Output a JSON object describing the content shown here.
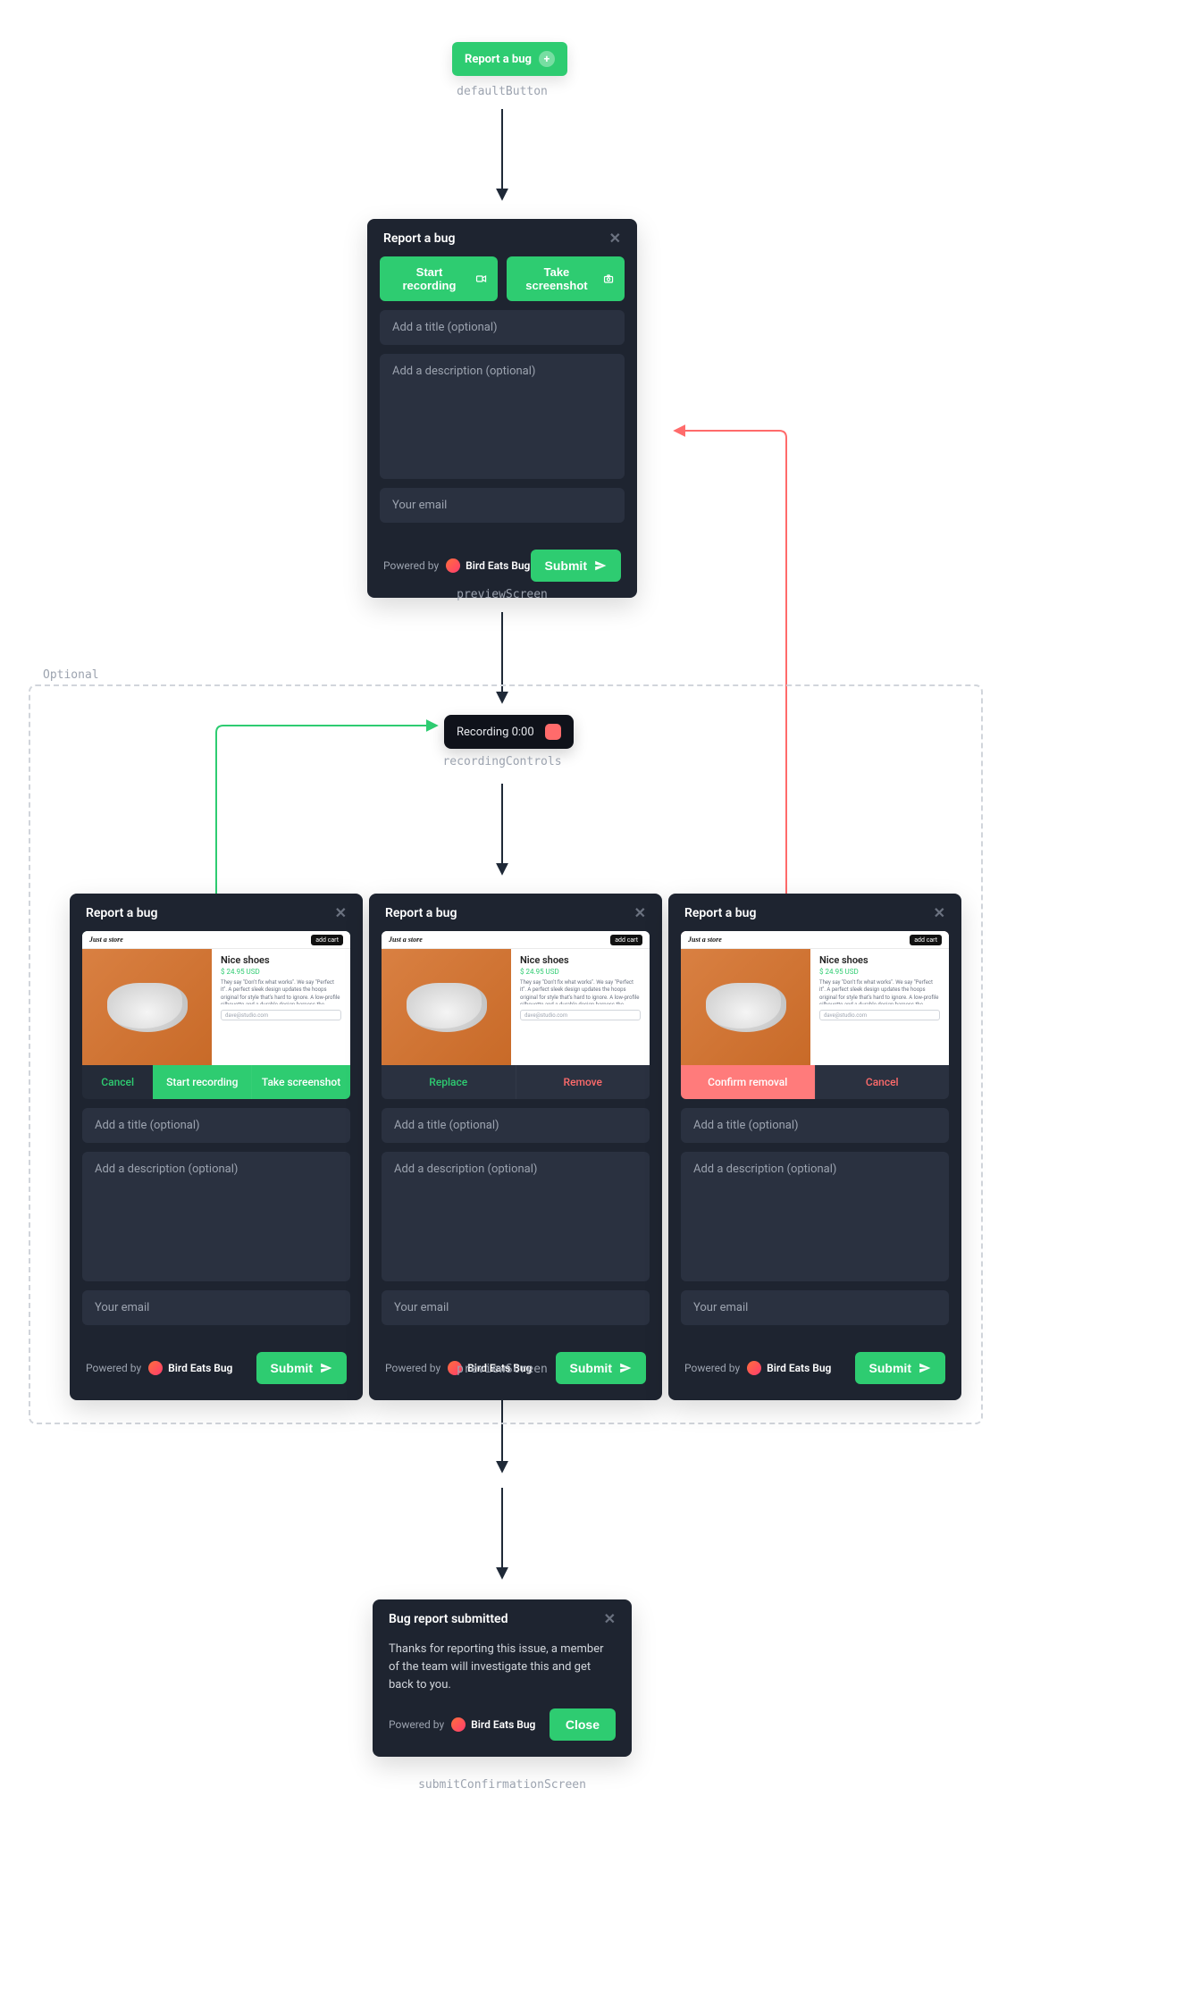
{
  "flow": {
    "optional_label": "Optional"
  },
  "labels": {
    "defaultButton": "defaultButton",
    "previewScreen1": "previewScreen",
    "recordingControls": "recordingControls",
    "previewScreen2": "previewScreen",
    "submitConfirmationScreen": "submitConfirmationScreen"
  },
  "defaultButton": {
    "label": "Report a bug"
  },
  "preview": {
    "title": "Report a bug",
    "start_recording": "Start recording",
    "take_screenshot": "Take screenshot",
    "title_placeholder": "Add a title (optional)",
    "description_placeholder": "Add a description (optional)",
    "email_placeholder": "Your email",
    "submit": "Submit",
    "powered_by": "Powered by",
    "brand": "Bird Eats Bug"
  },
  "recording": {
    "text": "Recording 0:00"
  },
  "states": {
    "left": {
      "title": "Report a bug",
      "actions": {
        "a": "Cancel",
        "b": "Start recording",
        "c": "Take screenshot"
      }
    },
    "middle": {
      "title": "Report a bug",
      "actions": {
        "a": "Replace",
        "b": "Remove"
      }
    },
    "right": {
      "title": "Report a bug",
      "actions": {
        "a": "Confirm removal",
        "b": "Cancel"
      }
    },
    "mock": {
      "brand": "Just a store",
      "cart": "add cart",
      "title": "Nice shoes",
      "price": "$ 24.95 USD",
      "blurb": "They say \"Don't fix what works\". We say \"Perfect it\". A perfect sleek design updates the hoops original for style that's hard to ignore. A low-profile silhouette and a durable design harness the simplified look you love while adobe foam on the tongue and plush collar details add tried-and-tested comfort — it's a no-brainer.",
      "email_hint": "dave@studio.com"
    },
    "form": {
      "title_placeholder": "Add a title (optional)",
      "description_placeholder": "Add a description (optional)",
      "email_placeholder": "Your email",
      "submit": "Submit",
      "powered_by": "Powered by",
      "brand": "Bird Eats Bug"
    }
  },
  "confirmation": {
    "title": "Bug report submitted",
    "body": "Thanks for reporting this issue, a member of the team will investigate this and get back to you.",
    "close": "Close",
    "powered_by": "Powered by",
    "brand": "Bird Eats Bug"
  }
}
